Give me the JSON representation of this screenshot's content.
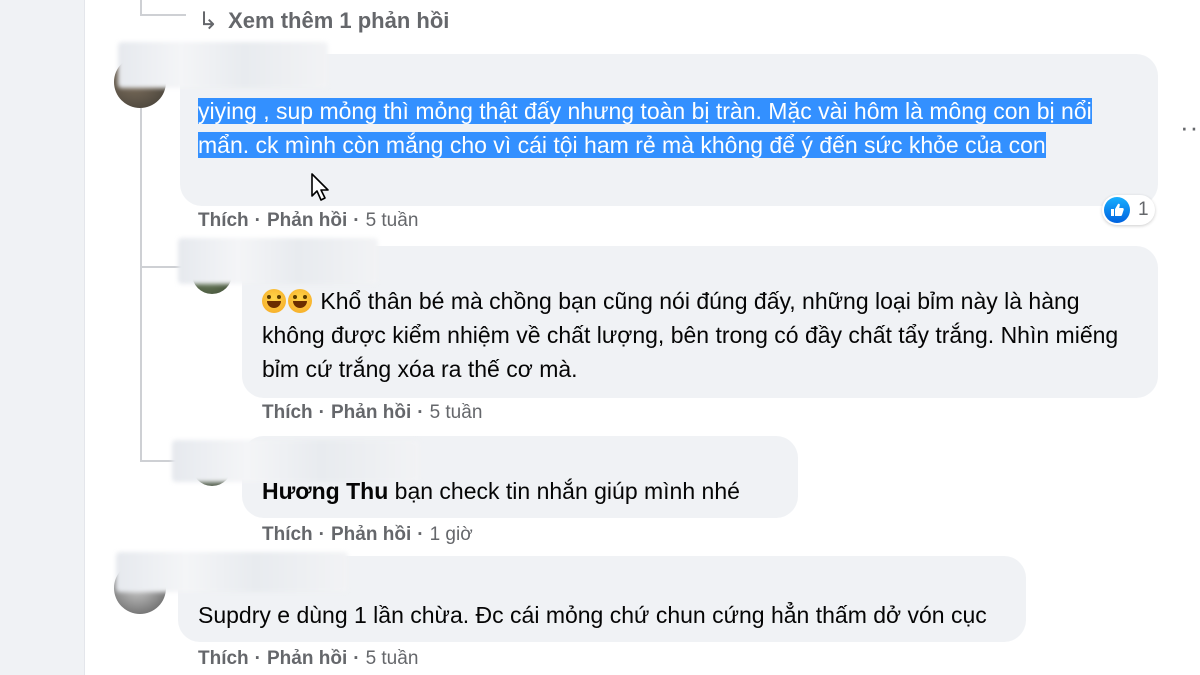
{
  "thread": {
    "see_more_replies": "Xem thêm 1 phản hồi"
  },
  "comments": [
    {
      "text_highlighted": "yiying , sup mỏng thì mỏng thật đấy nhưng toàn bị tràn. Mặc vài hôm là mông con bị nổi mẩn. ck mình còn mắng cho vì cái tội ham rẻ mà không để ý đến sức khỏe của con",
      "like_label": "Thích",
      "reply_label": "Phản hồi",
      "time": "5 tuần",
      "reaction_count": "1"
    },
    {
      "text": "Khổ thân bé mà chồng bạn cũng nói đúng đấy, những loại bỉm này là hàng không được kiểm nhiệm về chất lượng, bên trong có đầy chất tẩy trắng. Nhìn miếng bỉm cứ trắng xóa ra thế cơ mà.",
      "like_label": "Thích",
      "reply_label": "Phản hồi",
      "time": "5 tuần"
    },
    {
      "mention": "Hương Thu",
      "text": "bạn check tin nhắn giúp mình nhé",
      "like_label": "Thích",
      "reply_label": "Phản hồi",
      "time": "1 giờ"
    },
    {
      "text": "Supdry e dùng 1 lần chừa. Đc cái mỏng chứ chun cứng hẳn thấm dở vón cục",
      "like_label": "Thích",
      "reply_label": "Phản hồi",
      "time": "5 tuần"
    }
  ],
  "icons": {
    "reply_arrow": "↳",
    "more_options": "···",
    "like_reaction": "thumbs-up-icon"
  },
  "colors": {
    "selection": "#3390ff",
    "bubble": "#f0f2f5",
    "secondary_text": "#65676b",
    "like_blue": "#0866ff"
  }
}
